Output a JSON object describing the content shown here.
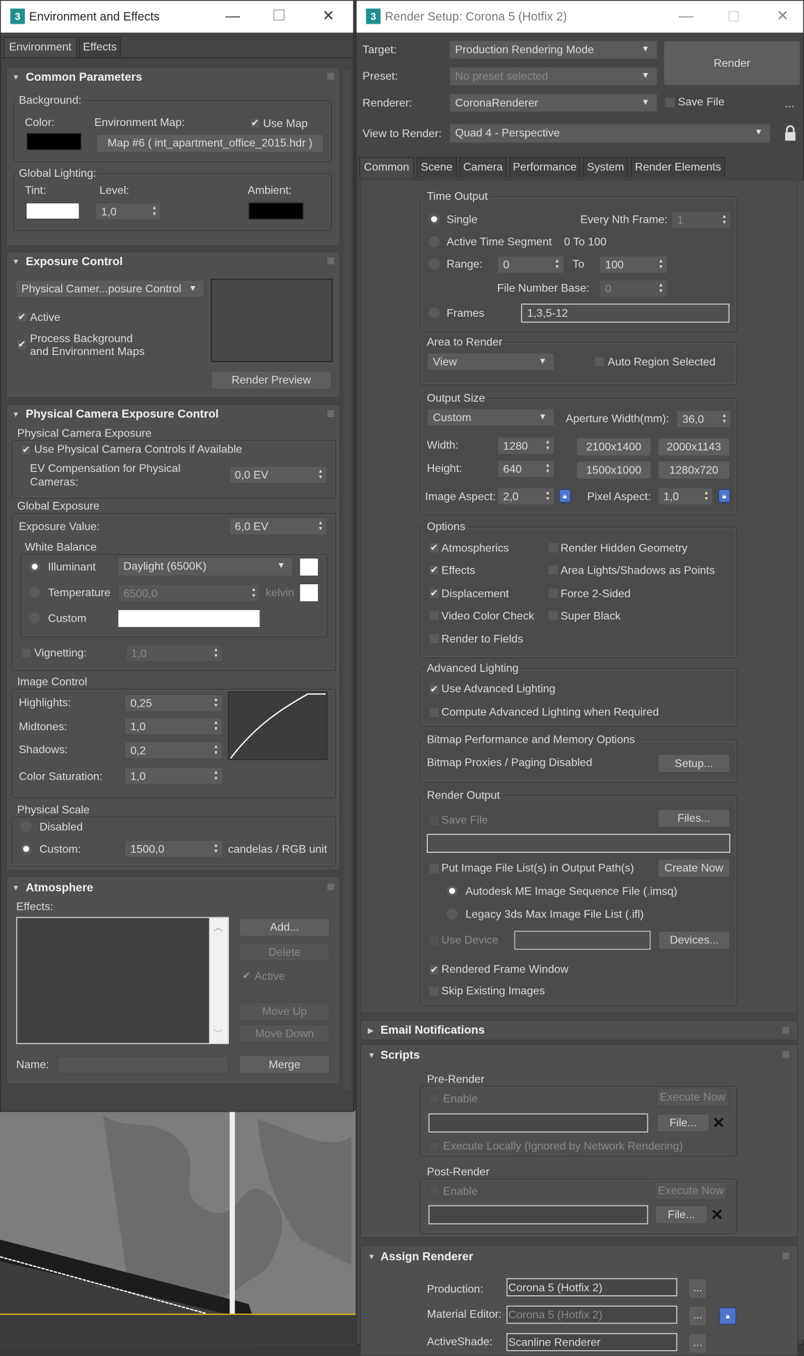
{
  "env": {
    "title": "Environment and Effects",
    "tabs": [
      "Environment",
      "Effects"
    ],
    "common": {
      "header": "Common Parameters",
      "background": "Background:",
      "color": "Color:",
      "env_map": "Environment Map:",
      "use_map": "Use Map",
      "use_map_checked": true,
      "map_button": "Map #6 ( int_apartment_office_2015.hdr )",
      "global_lighting": "Global Lighting:",
      "tint": "Tint:",
      "level": "Level:",
      "level_value": "1,0",
      "ambient": "Ambient:",
      "color_value": "#000000",
      "tint_value": "#ffffff",
      "ambient_value": "#000000"
    },
    "exposure": {
      "header": "Exposure Control",
      "type": "Physical Camer...posure Control",
      "active": "Active",
      "active_checked": true,
      "process_bg_1": "Process Background",
      "process_bg_2": "and Environment Maps",
      "process_checked": true,
      "render_preview": "Render Preview"
    },
    "physcam": {
      "header": "Physical Camera Exposure Control",
      "group": "Physical Camera Exposure",
      "use_controls": "Use Physical Camera Controls if Available",
      "use_controls_checked": true,
      "ev_comp_1": "EV Compensation for Physical",
      "ev_comp_2": "Cameras:",
      "ev_comp_value": "0,0 EV",
      "global_exposure": "Global Exposure",
      "exposure_value_label": "Exposure Value:",
      "exposure_value": "6,0 EV",
      "white_balance": "White Balance",
      "illuminant": "Illuminant",
      "illuminant_value": "Daylight (6500K)",
      "temperature": "Temperature",
      "temperature_value": "6500,0",
      "kelvin": "kelvin",
      "custom": "Custom",
      "white_balance_selected": "Illuminant",
      "vignetting": "Vignetting:",
      "vignetting_value": "1,0",
      "vignetting_checked": false,
      "image_control": "Image Control",
      "highlights": "Highlights:",
      "highlights_value": "0,25",
      "midtones": "Midtones:",
      "midtones_value": "1,0",
      "shadows": "Shadows:",
      "shadows_value": "0,2",
      "saturation": "Color Saturation:",
      "saturation_value": "1,0",
      "physical_scale": "Physical Scale",
      "disabled": "Disabled",
      "custom_scale": "Custom:",
      "custom_scale_value": "1500,0",
      "unit": "candelas / RGB unit",
      "physical_scale_selected": "Custom"
    },
    "atmosphere": {
      "header": "Atmosphere",
      "effects": "Effects:",
      "add": "Add...",
      "delete": "Delete",
      "active": "Active",
      "move_up": "Move Up",
      "move_down": "Move Down",
      "name": "Name:",
      "name_value": "",
      "merge": "Merge"
    }
  },
  "render": {
    "title": "Render Setup: Corona 5 (Hotfix 2)",
    "target_label": "Target:",
    "target": "Production Rendering Mode",
    "preset_label": "Preset:",
    "preset": "No preset selected",
    "renderer_label": "Renderer:",
    "renderer": "CoronaRenderer",
    "render_button": "Render",
    "save_file": "Save File",
    "save_file_checked": false,
    "more": "...",
    "view_label": "View to Render:",
    "view": "Quad 4 - Perspective",
    "tabs": [
      "Common",
      "Scene",
      "Camera",
      "Performance",
      "System",
      "Render Elements"
    ],
    "active_tab": "Common",
    "time_output": {
      "label": "Time Output",
      "single": "Single",
      "every_nth": "Every Nth Frame:",
      "every_nth_value": "1",
      "active_segment": "Active Time Segment",
      "segment_value": "0 To 100",
      "range": "Range:",
      "range_from": "0",
      "to": "To",
      "range_to": "100",
      "file_number_base": "File Number Base:",
      "file_number_base_value": "0",
      "frames": "Frames",
      "frames_value": "1,3,5-12",
      "selected": "Single"
    },
    "area": {
      "label": "Area to Render",
      "value": "View",
      "auto_region": "Auto Region Selected",
      "auto_region_checked": false
    },
    "output_size": {
      "label": "Output Size",
      "preset": "Custom",
      "aperture_label": "Aperture Width(mm):",
      "aperture": "36,0",
      "width_label": "Width:",
      "width": "1280",
      "height_label": "Height:",
      "height": "640",
      "presets": [
        "2100x1400",
        "2000x1143",
        "1500x1000",
        "1280x720"
      ],
      "image_aspect_label": "Image Aspect:",
      "image_aspect": "2,0",
      "pixel_aspect_label": "Pixel Aspect:",
      "pixel_aspect": "1,0"
    },
    "options": {
      "label": "Options",
      "items": [
        {
          "label": "Atmospherics",
          "checked": true
        },
        {
          "label": "Effects",
          "checked": true
        },
        {
          "label": "Displacement",
          "checked": true
        },
        {
          "label": "Video Color Check",
          "checked": false
        },
        {
          "label": "Render to Fields",
          "checked": false
        },
        {
          "label": "Render Hidden Geometry",
          "checked": false
        },
        {
          "label": "Area Lights/Shadows as Points",
          "checked": false
        },
        {
          "label": "Force 2-Sided",
          "checked": false
        },
        {
          "label": "Super Black",
          "checked": false
        }
      ]
    },
    "advanced_lighting": {
      "label": "Advanced Lighting",
      "use": "Use Advanced Lighting",
      "use_checked": true,
      "compute": "Compute Advanced Lighting when Required",
      "compute_checked": false
    },
    "bitmap": {
      "label": "Bitmap Performance and Memory Options",
      "status": "Bitmap Proxies / Paging Disabled",
      "setup": "Setup..."
    },
    "render_output": {
      "label": "Render Output",
      "save_file": "Save File",
      "files": "Files...",
      "path": "",
      "put_list": "Put Image File List(s) in Output Path(s)",
      "create_now": "Create Now",
      "imsq": "Autodesk ME Image Sequence File (.imsq)",
      "ifl": "Legacy 3ds Max Image File List (.ifl)",
      "use_device": "Use Device",
      "device": "",
      "devices": "Devices...",
      "rfw": "Rendered Frame Window",
      "rfw_checked": true,
      "skip": "Skip Existing Images",
      "skip_checked": false,
      "list_type_selected": "imsq"
    },
    "email": {
      "header": "Email Notifications"
    },
    "scripts": {
      "header": "Scripts",
      "pre": "Pre-Render",
      "post": "Post-Render",
      "enable": "Enable",
      "execute_now": "Execute Now",
      "file": "File...",
      "execute_locally": "Execute Locally (Ignored by Network Rendering)"
    },
    "assign": {
      "header": "Assign Renderer",
      "production_label": "Production:",
      "production": "Corona 5 (Hotfix 2)",
      "material_label": "Material Editor:",
      "material": "Corona 5 (Hotfix 2)",
      "activeshade_label": "ActiveShade:",
      "activeshade": "Scanline Renderer",
      "browse": "..."
    }
  },
  "colors": {
    "accent_lock": "#4f74c9",
    "viewport_highlight": "#c8b400"
  }
}
